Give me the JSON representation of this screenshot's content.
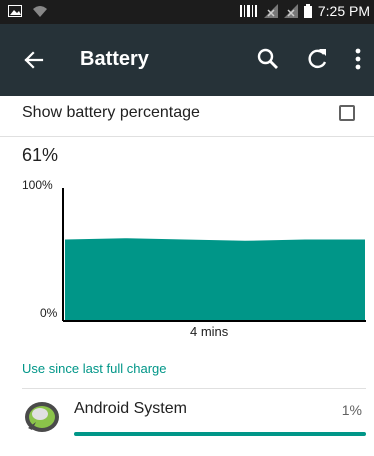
{
  "status_bar": {
    "time": "7:25 PM",
    "icons": [
      "image-notification-icon",
      "wifi-icon",
      "barcode-icon",
      "signal-icon",
      "signal-icon",
      "battery-icon"
    ]
  },
  "toolbar": {
    "title": "Battery",
    "icons": [
      "back-arrow-icon",
      "search-icon",
      "refresh-icon",
      "more-vert-icon"
    ]
  },
  "settings": {
    "show_percentage_label": "Show battery percentage",
    "show_percentage_checked": false
  },
  "battery": {
    "percent_label": "61%"
  },
  "chart_data": {
    "type": "area",
    "x": [
      "",
      "",
      "",
      "",
      "",
      ""
    ],
    "values": [
      61,
      62,
      61,
      60,
      61,
      61
    ],
    "y_labels": [
      "100%",
      "0%"
    ],
    "xlabel": "4 mins",
    "ylim": [
      0,
      100
    ],
    "color": "#009688"
  },
  "usage": {
    "header": "Use since last full charge",
    "items": [
      {
        "name": "Android System",
        "percent": "1%",
        "fraction": 1.0
      }
    ]
  },
  "colors": {
    "status_bar": "#1c1c1c",
    "toolbar": "#263238",
    "accent": "#009688"
  }
}
